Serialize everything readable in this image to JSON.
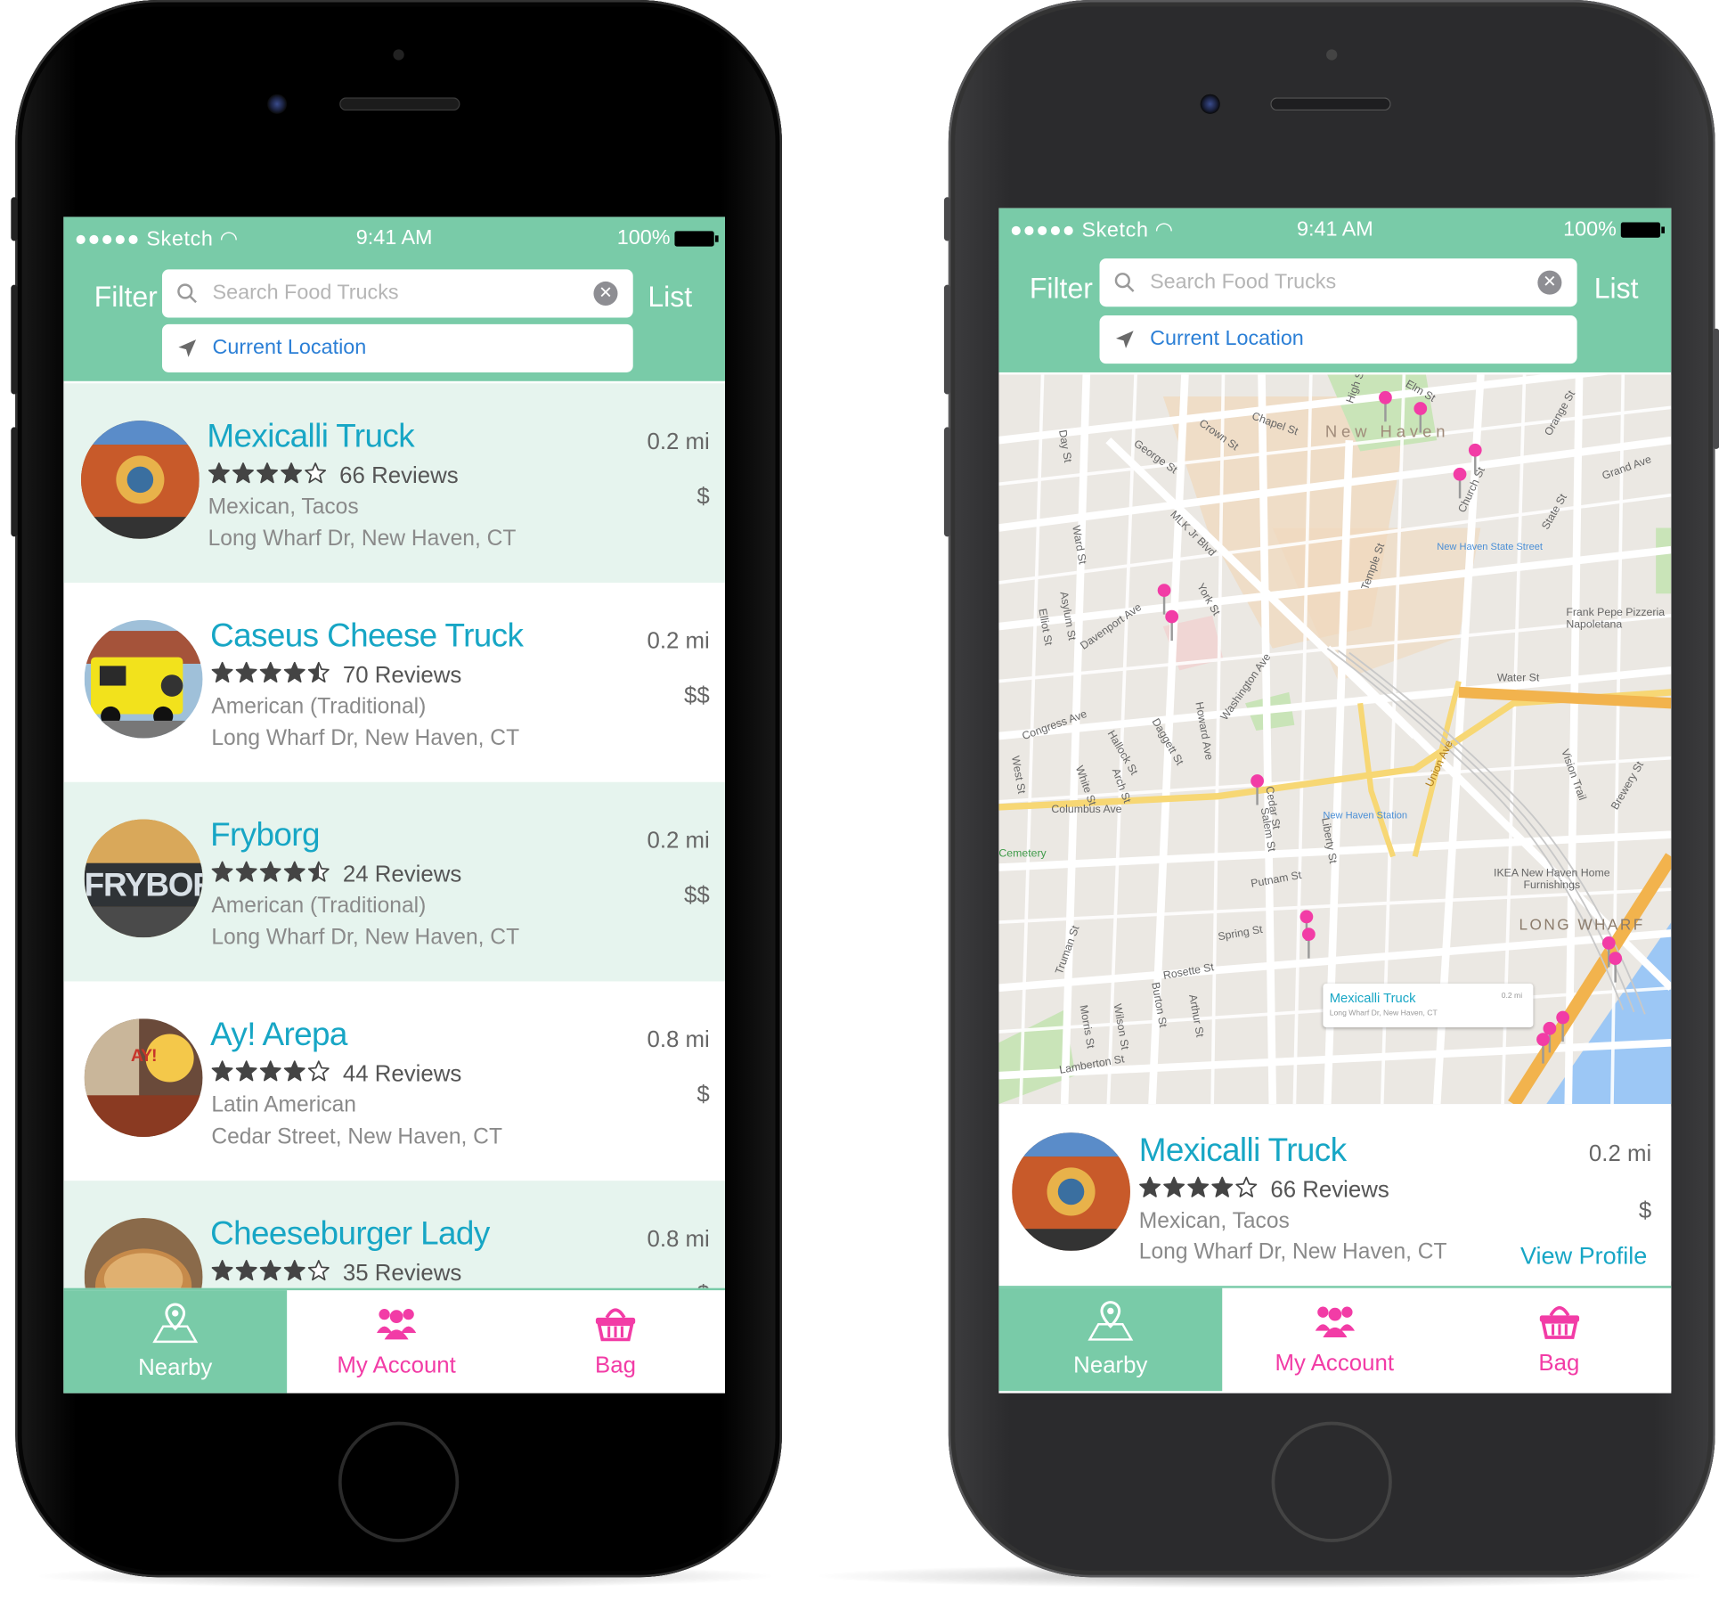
{
  "status": {
    "carrier": "Sketch",
    "time": "9:41 AM",
    "battery": "100%"
  },
  "header": {
    "filter_label": "Filter",
    "list_label": "List",
    "search_placeholder": "Search Food Trucks",
    "location_label": "Current Location"
  },
  "trucks": [
    {
      "name": "Mexicalli Truck",
      "rating": 4,
      "reviews": "66 Reviews",
      "category": "Mexican, Tacos",
      "address": "Long Wharf Dr, New Haven, CT",
      "distance": "0.2 mi",
      "price": "$"
    },
    {
      "name": "Caseus Cheese Truck",
      "rating": 4.5,
      "reviews": "70 Reviews",
      "category": "American (Traditional)",
      "address": "Long Wharf Dr, New Haven, CT",
      "distance": "0.2 mi",
      "price": "$$"
    },
    {
      "name": "Fryborg",
      "rating": 4.5,
      "reviews": "24 Reviews",
      "category": "American (Traditional)",
      "address": "Long Wharf Dr, New Haven, CT",
      "distance": "0.2 mi",
      "price": "$$",
      "avatar_text": "FRYBORG"
    },
    {
      "name": "Ay! Arepa",
      "rating": 4,
      "reviews": "44 Reviews",
      "category": "Latin American",
      "address": "Cedar Street, New Haven, CT",
      "distance": "0.8 mi",
      "price": "$",
      "avatar_text": "AY!"
    },
    {
      "name": "Cheeseburger Lady",
      "rating": 4,
      "reviews": "35 Reviews",
      "category": "",
      "address": "",
      "distance": "0.8 mi",
      "price": "$"
    }
  ],
  "tabs": {
    "nearby": "Nearby",
    "account": "My Account",
    "bag": "Bag"
  },
  "map": {
    "area_label": "New Haven",
    "district_label": "LONG WHARF",
    "streets": [
      "Chapel St",
      "George St",
      "Crown St",
      "Elm St",
      "Grand Ave",
      "Orange St",
      "State St",
      "Church St",
      "Temple St",
      "Water St",
      "Columbus Ave",
      "Congress Ave",
      "Davenport Ave",
      "Howard Ave",
      "Washington Ave",
      "Putnam St",
      "Spring St",
      "Rosette St",
      "Lamberton St",
      "Union Ave",
      "Cedar St",
      "Liberty St",
      "MLK Jr Blvd",
      "York St",
      "Asylum St",
      "Ward St",
      "Daggett St",
      "Hallock St",
      "Arch St",
      "White St",
      "Truman St",
      "Wilson St",
      "Morris St",
      "Burton St",
      "Arthur St",
      "Salem St",
      "Frank Pepe Pizzeria Napoletana",
      "New Haven State Street",
      "New Haven Station",
      "IKEA New Haven Home Furnishings",
      "Vision Trail",
      "Brewery St",
      "West St",
      "Day St",
      "Elliot St",
      "Cemetery",
      "High St"
    ],
    "callout_name": "Mexicalli Truck",
    "callout_addr": "Long Wharf Dr, New Haven, CT",
    "callout_dist": "0.2 mi"
  },
  "detail": {
    "name": "Mexicalli Truck",
    "rating": 4,
    "reviews": "66 Reviews",
    "category": "Mexican, Tacos",
    "address": "Long Wharf Dr, New Haven, CT",
    "distance": "0.2 mi",
    "price": "$",
    "view_profile": "View Profile"
  },
  "colors": {
    "header": "#79cba8",
    "accent": "#17a6c5",
    "pink": "#f23ca6",
    "row_tint": "#e6f4ee",
    "location_blue": "#2b7fd6"
  }
}
